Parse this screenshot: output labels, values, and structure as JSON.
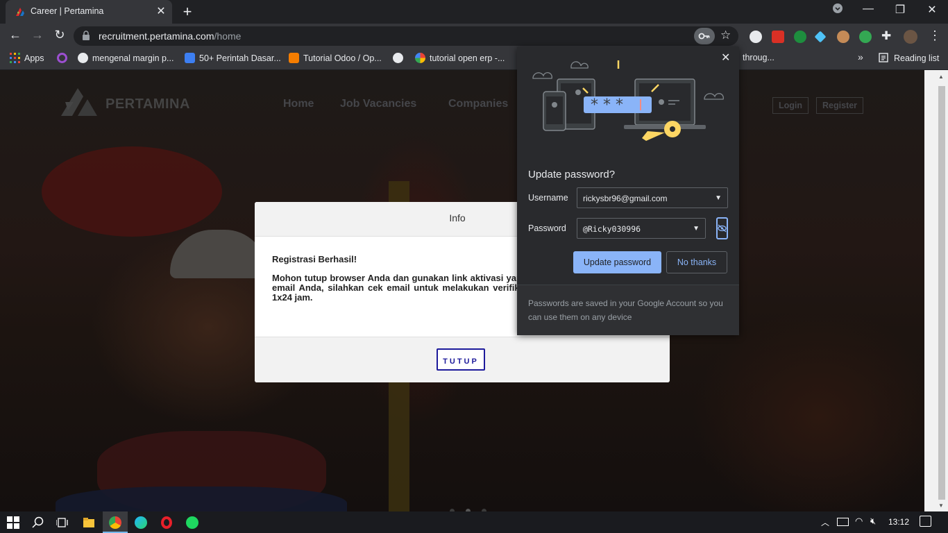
{
  "browser": {
    "tab_title": "Career | Pertamina",
    "new_tab": "+",
    "url_host": "recruitment.pertamina.com",
    "url_path": "/home",
    "bookmarks": [
      {
        "label": "Apps",
        "icon": "apps-grid-icon",
        "color": "#e8eaed"
      },
      {
        "label": "",
        "icon": "circle-icon",
        "color": "#9c4fd0"
      },
      {
        "label": "mengenal margin p...",
        "icon": "wordpress-icon",
        "color": "#e8eaed"
      },
      {
        "label": "50+ Perintah Dasar...",
        "icon": "bookmark-site-icon",
        "color": "#3d7ff2"
      },
      {
        "label": "Tutorial Odoo / Op...",
        "icon": "blogger-icon",
        "color": "#f57d00"
      },
      {
        "label": "",
        "icon": "globe-icon",
        "color": "#e8eaed"
      },
      {
        "label": "tutorial open erp -...",
        "icon": "google-icon",
        "color": "#4285f4"
      }
    ],
    "bookmark_overflow_text": "throug...",
    "more_bookmarks": "»",
    "reading_list": "Reading list"
  },
  "site": {
    "logo_text": "PERTAMINA",
    "nav": [
      "Home",
      "Job Vacancies",
      "Companies"
    ],
    "login": "Login",
    "register": "Register"
  },
  "modal": {
    "title": "Info",
    "heading": "Registrasi Berhasil!",
    "body": "Mohon tutup browser Anda dan gunakan link aktivasi yang konfirmasi telah dikirimkan ke email Anda, silahkan cek email untuk melakukan verifikasi akun. Batas waktu verifikasi 1x24 jam.",
    "button": "TUTUP"
  },
  "password_prompt": {
    "title": "Update password?",
    "username_label": "Username",
    "username_value": "rickysbr96@gmail.com",
    "password_label": "Password",
    "password_value": "@Ricky030996",
    "update_button": "Update password",
    "no_thanks_button": "No thanks",
    "footer": "Passwords are saved in your Google Account so you can use them on any device"
  },
  "taskbar": {
    "time": "13:12"
  },
  "colors": {
    "accent": "#8ab4f8",
    "modal_button": "#1d1a9b",
    "chrome_dark": "#202124"
  }
}
